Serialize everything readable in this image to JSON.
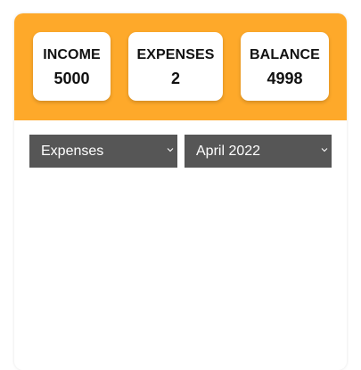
{
  "summary": {
    "income": {
      "label": "INCOME",
      "value": "5000"
    },
    "expenses": {
      "label": "EXPENSES",
      "value": "2"
    },
    "balance": {
      "label": "BALANCE",
      "value": "4998"
    }
  },
  "filters": {
    "type_selected": "Expenses",
    "month_selected": "April 2022"
  },
  "colors": {
    "accent": "#FEA92A",
    "select_bg": "#565656"
  },
  "icons": {
    "dropdown": "chevron-down-icon"
  }
}
